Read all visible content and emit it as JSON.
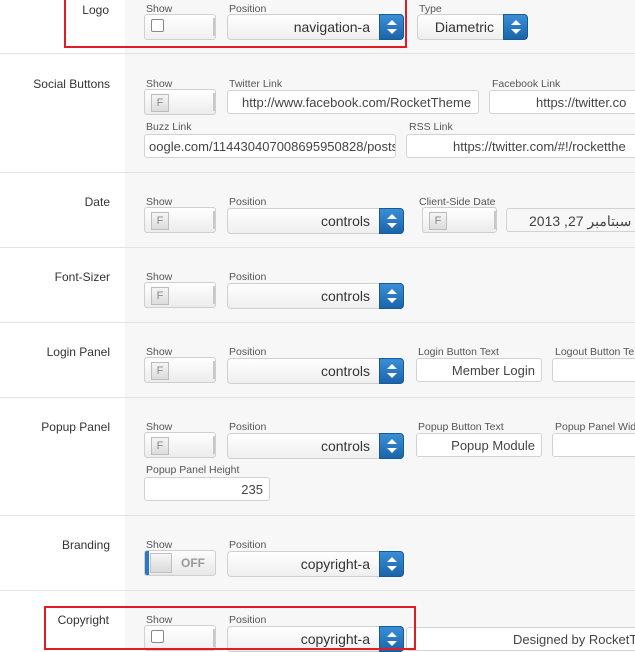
{
  "rows": {
    "logo": {
      "label": "Logo",
      "show_label": "Show",
      "position_label": "Position",
      "position_value": "navigation-a",
      "type_label": "Type",
      "type_value": "Diametric"
    },
    "social": {
      "label": "Social Buttons",
      "show_label": "Show",
      "show_value": "F",
      "twitter_label": "Twitter Link",
      "twitter_value": "http://www.facebook.com/RocketTheme",
      "facebook_label": "Facebook Link",
      "facebook_value": "https://twitter.co",
      "buzz_label": "Buzz Link",
      "buzz_value": "oogle.com/114430407008695950828/posts",
      "rss_label": "RSS Link",
      "rss_value": "https://twitter.com/#!/rocketthe"
    },
    "date": {
      "label": "Date",
      "show_label": "Show",
      "show_value": "F",
      "position_label": "Position",
      "position_value": "controls",
      "client_label": "Client-Side Date",
      "client_show_value": "F",
      "date_value": "سبتامبر 27, 2013"
    },
    "fontsizer": {
      "label": "Font-Sizer",
      "show_label": "Show",
      "show_value": "F",
      "position_label": "Position",
      "position_value": "controls"
    },
    "login": {
      "label": "Login Panel",
      "show_label": "Show",
      "show_value": "F",
      "position_label": "Position",
      "position_value": "controls",
      "button_label": "Login Button Text",
      "button_value": "Member Login",
      "logout_label": "Logout Button Te"
    },
    "popup": {
      "label": "Popup Panel",
      "show_label": "Show",
      "show_value": "F",
      "position_label": "Position",
      "position_value": "controls",
      "button_label": "Popup Button Text",
      "button_value": "Popup Module",
      "width_label": "Popup Panel Wid",
      "height_label": "Popup Panel Height",
      "height_value": "235"
    },
    "branding": {
      "label": "Branding",
      "show_label": "Show",
      "show_value": "OFF",
      "position_label": "Position",
      "position_value": "copyright-a"
    },
    "copyright": {
      "label": "Copyright",
      "show_label": "Show",
      "position_label": "Position",
      "position_value": "copyright-a",
      "text_value": "Designed by RocketTh"
    }
  },
  "colors": {
    "accent": "#1b64aa",
    "highlight": "#e21b26"
  }
}
